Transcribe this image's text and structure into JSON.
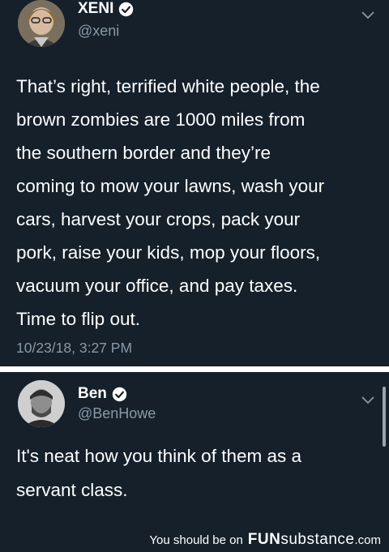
{
  "tweet1": {
    "display_name": "XENI",
    "handle": "@xeni",
    "text": "That’s right, terrified white people, the\nbrown zombies are 1000 miles from\nthe southern border and they’re\ncoming to mow your lawns,  wash your\ncars, harvest your crops, pack your\npork, raise your kids, mop your floors,\nvacuum your office, and pay taxes.\nTime to flip out.",
    "timestamp": "10/23/18, 3:27 PM",
    "verified_icon": "verified-badge-icon",
    "menu_icon": "chevron-down-icon"
  },
  "tweet2": {
    "display_name": "Ben",
    "handle": "@BenHowe",
    "text": "It's neat how you think of them as a\nservant class.",
    "verified_icon": "verified-badge-icon",
    "menu_icon": "chevron-down-icon"
  },
  "footer": {
    "prefix": "You should be on",
    "brand_fun": "FUN",
    "brand_substance": "substance",
    "tld": ".com"
  },
  "colors": {
    "background": "#15202b",
    "text": "#ffffff",
    "secondary": "#8899a6"
  }
}
